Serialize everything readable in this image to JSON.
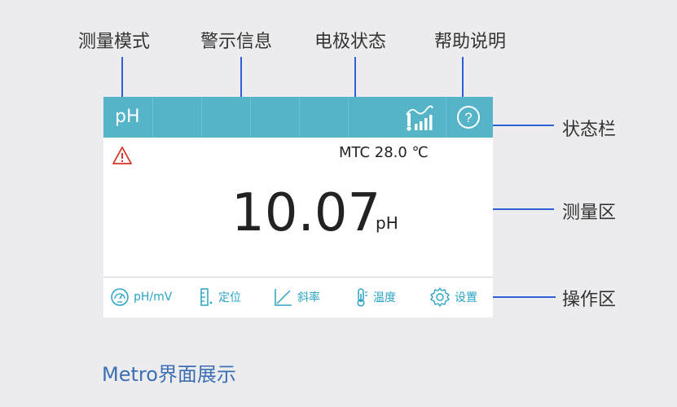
{
  "callouts": {
    "measure_mode": "测量模式",
    "warning_info": "警示信息",
    "electrode_status": "电极状态",
    "help": "帮助说明",
    "status_bar": "状态栏",
    "measure_area": "测量区",
    "operation_area": "操作区"
  },
  "status_bar": {
    "mode": "pH",
    "icons": [
      "electrode-signal-icon",
      "help-icon"
    ],
    "background": "#55b4c8"
  },
  "measure": {
    "warning_icon": "warning-icon",
    "temperature": "MTC 28.0 ℃",
    "value": "10.07",
    "unit": "pH"
  },
  "operations": [
    {
      "icon": "gauge-icon",
      "label": "pH/mV"
    },
    {
      "icon": "ruler-icon",
      "label": "定位"
    },
    {
      "icon": "slope-icon",
      "label": "斜率"
    },
    {
      "icon": "thermometer-icon",
      "label": "温度"
    },
    {
      "icon": "gear-icon",
      "label": "设置"
    }
  ],
  "footer": {
    "caption": "Metro界面展示"
  },
  "colors": {
    "accent": "#2aa4c3",
    "callout_line": "#2f5fd6",
    "warning": "#d9342b",
    "caption": "#3d6fb4"
  }
}
